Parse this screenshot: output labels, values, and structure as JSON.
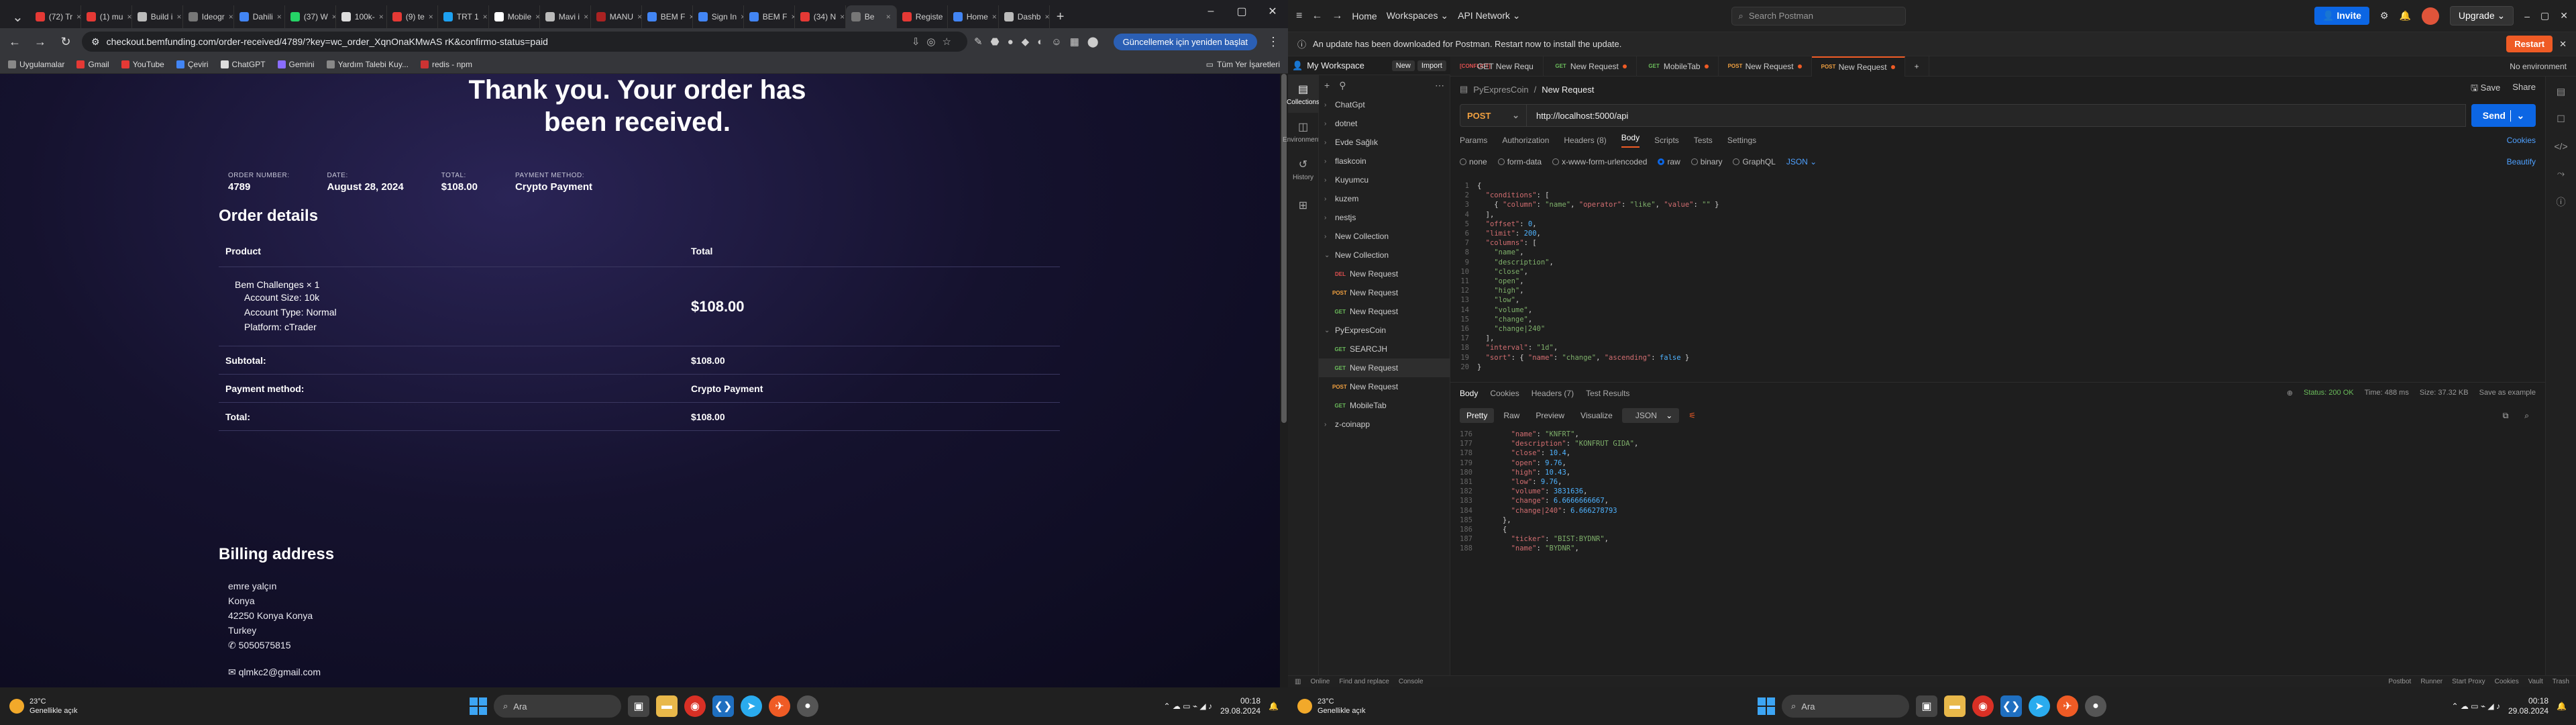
{
  "chrome": {
    "tabs": [
      {
        "label": "(72) Tr",
        "color": "#e53935"
      },
      {
        "label": "(1) mu",
        "color": "#e53935"
      },
      {
        "label": "Build i",
        "color": "#bbbbbb"
      },
      {
        "label": "Ideogr",
        "color": "#777777"
      },
      {
        "label": "Dahili",
        "color": "#4285f4"
      },
      {
        "label": "(37) W",
        "color": "#25d366"
      },
      {
        "label": "100k-",
        "color": "#dddddd"
      },
      {
        "label": "(9) te",
        "color": "#e53935"
      },
      {
        "label": "TRT 1",
        "color": "#1da1f2"
      },
      {
        "label": "Mobile",
        "color": "#ffffff"
      },
      {
        "label": "Mavi i",
        "color": "#bbbbbb"
      },
      {
        "label": "MANU",
        "color": "#aa2222"
      },
      {
        "label": "BEM F",
        "color": "#4285f4"
      },
      {
        "label": "Sign In",
        "color": "#4285f4"
      },
      {
        "label": "BEM F",
        "color": "#4285f4"
      },
      {
        "label": "(34) N",
        "color": "#e53935"
      },
      {
        "label": "Be",
        "color": "#777777",
        "active": true
      },
      {
        "label": "Registe",
        "color": "#e53935"
      },
      {
        "label": "Home",
        "color": "#4285f4"
      },
      {
        "label": "Dashb",
        "color": "#bbbbbb"
      }
    ],
    "url": "checkout.bemfunding.com/order-received/4789/?key=wc_order_XqnOnaKMwAS rK&confirmo-status=paid",
    "update_button": "Güncellemek için yeniden başlat",
    "bookmarks": [
      {
        "label": "Uygulamalar",
        "color": "#888888"
      },
      {
        "label": "Gmail",
        "color": "#e53935"
      },
      {
        "label": "YouTube",
        "color": "#e53935"
      },
      {
        "label": "Çeviri",
        "color": "#4285f4"
      },
      {
        "label": "ChatGPT",
        "color": "#dddddd"
      },
      {
        "label": "Gemini",
        "color": "#8a6dff"
      },
      {
        "label": "Yardım Talebi Kuy...",
        "color": "#888888"
      },
      {
        "label": "redis - npm",
        "color": "#cc3333"
      }
    ],
    "bookmarks_all": "Tüm Yer İşaretleri"
  },
  "order": {
    "title": "Thank you. Your order has been received.",
    "meta": [
      {
        "key": "ORDER NUMBER:",
        "value": "4789"
      },
      {
        "key": "DATE:",
        "value": "August 28, 2024"
      },
      {
        "key": "TOTAL:",
        "value": "$108.00"
      },
      {
        "key": "PAYMENT METHOD:",
        "value": "Crypto Payment"
      }
    ],
    "details_heading": "Order details",
    "col_product": "Product",
    "col_total": "Total",
    "item_name": "Bem Challenges × 1",
    "item_attrs": [
      {
        "k": "Account Size:",
        "v": "10k"
      },
      {
        "k": "Account Type:",
        "v": "Normal"
      },
      {
        "k": "Platform:",
        "v": "cTrader"
      }
    ],
    "item_total": "$108.00",
    "subtotal_label": "Subtotal:",
    "subtotal_value": "$108.00",
    "payment_label": "Payment method:",
    "payment_value": "Crypto Payment",
    "total_label": "Total:",
    "total_value": "$108.00",
    "billing_heading": "Billing address",
    "billing_lines": [
      "emre yalçın",
      "Konya",
      "42250 Konya Konya",
      "Turkey"
    ],
    "billing_phone": "5050575815",
    "billing_email": "qlmkc2@gmail.com"
  },
  "taskbar_left": {
    "temp": "23°C",
    "weather": "Genellikle açık",
    "search": "Ara",
    "time": "00:18",
    "date": "29.08.2024"
  },
  "postman": {
    "home": "Home",
    "workspaces": "Workspaces",
    "api_network": "API Network",
    "search": "Search Postman",
    "invite": "Invite",
    "upgrade": "Upgrade",
    "banner": "An update has been downloaded for Postman. Restart now to install the update.",
    "restart": "Restart",
    "workspace": "My Workspace",
    "new_btn": "New",
    "import_btn": "Import",
    "rail": [
      "Collections",
      "Environments",
      "History",
      ""
    ],
    "tabs": [
      {
        "method": "[CONFLICT]",
        "mcls": "del",
        "label": "GET New Requ",
        "dot": false
      },
      {
        "method": "GET",
        "mcls": "get",
        "label": "New Request",
        "dot": true
      },
      {
        "method": "GET",
        "mcls": "get",
        "label": "MobileTab",
        "dot": true
      },
      {
        "method": "POST",
        "mcls": "post",
        "label": "New Request",
        "dot": true
      },
      {
        "method": "POST",
        "mcls": "post",
        "label": "New Request",
        "dot": true,
        "active": true
      }
    ],
    "no_env": "No environment",
    "tree": [
      {
        "label": "ChatGpt",
        "depth": 0,
        "type": "folder",
        "open": false
      },
      {
        "label": "dotnet",
        "depth": 0,
        "type": "folder",
        "open": false
      },
      {
        "label": "Evde Sağlık",
        "depth": 0,
        "type": "folder",
        "open": false
      },
      {
        "label": "flaskcoin",
        "depth": 0,
        "type": "folder",
        "open": false
      },
      {
        "label": "Kuyumcu",
        "depth": 0,
        "type": "folder",
        "open": false
      },
      {
        "label": "kuzem",
        "depth": 0,
        "type": "folder",
        "open": false
      },
      {
        "label": "nestjs",
        "depth": 0,
        "type": "folder",
        "open": false
      },
      {
        "label": "New Collection",
        "depth": 0,
        "type": "folder",
        "open": false
      },
      {
        "label": "New Collection",
        "depth": 0,
        "type": "folder",
        "open": true
      },
      {
        "label": "New Request",
        "depth": 1,
        "type": "req",
        "method": "DEL",
        "mcls": "del"
      },
      {
        "label": "New Request",
        "depth": 1,
        "type": "req",
        "method": "POST",
        "mcls": "post"
      },
      {
        "label": "New Request",
        "depth": 1,
        "type": "req",
        "method": "GET",
        "mcls": "get"
      },
      {
        "label": "PyExpresCoin",
        "depth": 0,
        "type": "folder",
        "open": true
      },
      {
        "label": "SEARCJH",
        "depth": 1,
        "type": "req",
        "method": "GET",
        "mcls": "get"
      },
      {
        "label": "New Request",
        "depth": 1,
        "type": "req",
        "method": "GET",
        "mcls": "get",
        "sel": true
      },
      {
        "label": "New Request",
        "depth": 1,
        "type": "req",
        "method": "POST",
        "mcls": "post"
      },
      {
        "label": "MobileTab",
        "depth": 1,
        "type": "req",
        "method": "GET",
        "mcls": "get"
      },
      {
        "label": "z-coinapp",
        "depth": 0,
        "type": "folder",
        "open": false
      }
    ],
    "crumb_parent": "PyExpresCoin",
    "crumb_current": "New Request",
    "save": "Save",
    "share": "Share",
    "method": "POST",
    "url": "http://localhost:5000/api",
    "send": "Send",
    "req_tabs": [
      "Params",
      "Authorization",
      "Headers (8)",
      "Body",
      "Scripts",
      "Tests",
      "Settings"
    ],
    "cookies": "Cookies",
    "body_opts": [
      "none",
      "form-data",
      "x-www-form-urlencoded",
      "raw",
      "binary",
      "GraphQL"
    ],
    "body_format": "JSON",
    "beautify": "Beautify",
    "request_lines": [
      "{",
      "  \"conditions\": [",
      "    { \"column\": \"name\", \"operator\": \"like\", \"value\": \"\" }",
      "  ],",
      "  \"offset\": 0,",
      "  \"limit\": 200,",
      "  \"columns\": [",
      "    \"name\",",
      "    \"description\",",
      "    \"close\",",
      "    \"open\",",
      "    \"high\",",
      "    \"low\",",
      "    \"volume\",",
      "    \"change\",",
      "    \"change|240\"",
      "  ],",
      "  \"interval\": \"1d\",",
      "  \"sort\": { \"name\": \"change\", \"ascending\": false }",
      "}"
    ],
    "resp_tabs": [
      "Body",
      "Cookies",
      "Headers (7)",
      "Test Results"
    ],
    "status": "Status: 200 OK",
    "time": "Time: 488 ms",
    "size": "Size: 37.32 KB",
    "save_example": "Save as example",
    "view_modes": [
      "Pretty",
      "Raw",
      "Preview",
      "Visualize"
    ],
    "resp_format": "JSON",
    "response_start": 176,
    "response_lines": [
      "        \"name\": \"KNFRT\",",
      "        \"description\": \"KONFRUT GIDA\",",
      "        \"close\": 10.4,",
      "        \"open\": 9.76,",
      "        \"high\": 10.43,",
      "        \"low\": 9.76,",
      "        \"volume\": 3831636,",
      "        \"change\": 6.6666666667,",
      "        \"change|240\": 6.666278793",
      "      },",
      "      {",
      "        \"ticker\": \"BIST:BYDNR\",",
      "        \"name\": \"BYDNR\","
    ],
    "status_bar": [
      "Online",
      "Find and replace",
      "Console"
    ],
    "status_bar_right": [
      "Postbot",
      "Runner",
      "Start Proxy",
      "Cookies",
      "Vault",
      "Trash"
    ]
  },
  "taskbar_right": {
    "temp": "23°C",
    "weather": "Genellikle açık",
    "search": "Ara",
    "time": "00:18",
    "date": "29.08.2024"
  }
}
